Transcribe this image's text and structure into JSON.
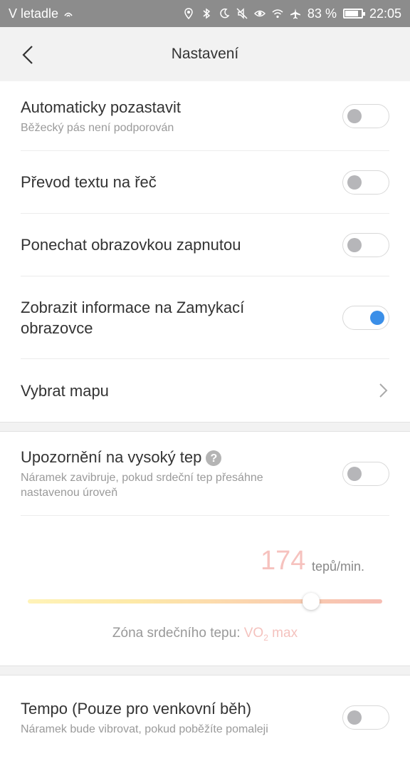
{
  "status_bar": {
    "airplane_mode_text": "V letadle",
    "battery": "83 %",
    "battery_level": 0.83,
    "time": "22:05",
    "icons": [
      "location-icon",
      "bluetooth-icon",
      "moon-icon",
      "mute-icon",
      "eye-icon",
      "wifi-icon",
      "airplane-icon",
      "battery-icon"
    ]
  },
  "header": {
    "title": "Nastavení",
    "back_icon": "chevron-left-icon"
  },
  "settings": {
    "auto_pause": {
      "title": "Automaticky pozastavit",
      "subtitle": "Běžecký pás není podporován",
      "enabled": false
    },
    "tts": {
      "title": "Převod textu na řeč",
      "enabled": false
    },
    "keep_screen_on": {
      "title": "Ponechat obrazovkou zapnutou",
      "enabled": false
    },
    "lock_screen_info": {
      "title_line1": "Zobrazit informace na Zamykací",
      "title_line2": "obrazovce",
      "enabled": true
    },
    "choose_map": {
      "title": "Vybrat mapu"
    }
  },
  "heart_rate": {
    "title": "Upozornění na vysoký tep",
    "subtitle_line1": "Náramek zavibruje, pokud srdeční tep přesáhne",
    "subtitle_line2": "nastavenou úroveň",
    "enabled": false,
    "value": "174",
    "unit": "tepů/min.",
    "slider_fraction": 0.8,
    "zone_label": "Zóna srdečního tepu: ",
    "zone_value_main": "VO",
    "zone_value_sub": "2",
    "zone_value_tail": " max"
  },
  "tempo": {
    "title": "Tempo (Pouze pro venkovní běh)",
    "subtitle": "Náramek bude vibrovat, pokud poběžíte pomaleji",
    "enabled": false
  },
  "colors": {
    "accent_blue": "#3b8fe8",
    "status_bar": "#8c8c8c",
    "hr_value": "#f6c2be"
  }
}
